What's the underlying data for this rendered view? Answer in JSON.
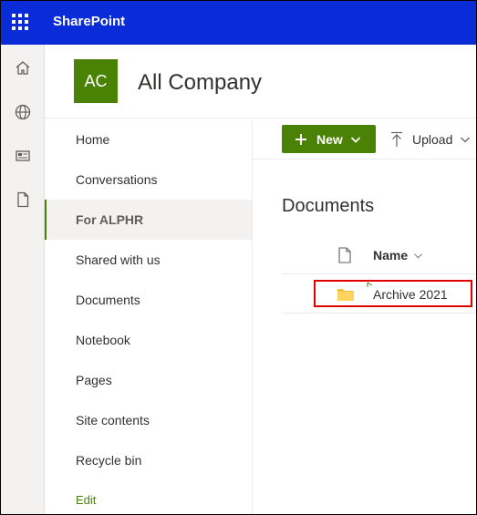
{
  "suitebar": {
    "app_name": "SharePoint"
  },
  "site": {
    "logo_initials": "AC",
    "title": "All Company"
  },
  "leftnav": {
    "items": [
      {
        "label": "Home"
      },
      {
        "label": "Conversations"
      },
      {
        "label": "For ALPHR",
        "selected": true
      },
      {
        "label": "Shared with us"
      },
      {
        "label": "Documents"
      },
      {
        "label": "Notebook"
      },
      {
        "label": "Pages"
      },
      {
        "label": "Site contents"
      },
      {
        "label": "Recycle bin"
      }
    ],
    "edit_label": "Edit"
  },
  "commandbar": {
    "new_label": "New",
    "upload_label": "Upload"
  },
  "documents": {
    "title": "Documents",
    "column_name": "Name",
    "rows": [
      {
        "name": "Archive 2021",
        "type": "folder"
      }
    ]
  },
  "icons": {
    "waffle": "app-launcher-icon",
    "rail": [
      "home-icon",
      "globe-icon",
      "news-icon",
      "document-icon"
    ]
  },
  "colors": {
    "suitebar": "#0a2bd8",
    "brand": "#498205",
    "highlight": "#e00000"
  }
}
